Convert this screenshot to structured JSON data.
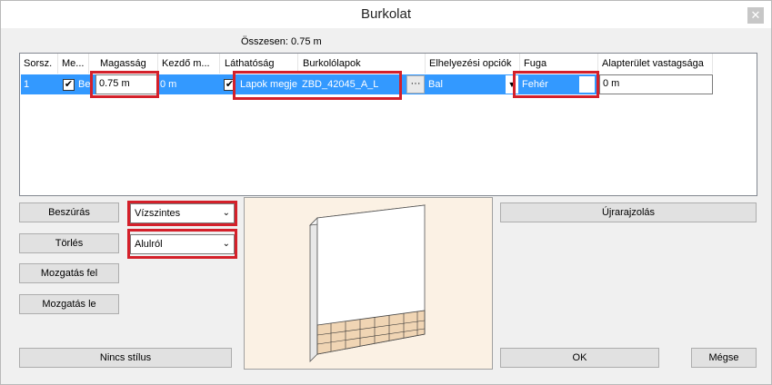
{
  "window": {
    "title": "Burkolat"
  },
  "summary": "Összesen: 0.75 m",
  "table": {
    "headers": [
      "Sorsz.",
      "Me...",
      "Magasság",
      "Kezdő m...",
      "Láthatóság",
      "Burkolólapok",
      "Elhelyezési opciók",
      "Fuga",
      "Alapterület vastagsága"
    ],
    "rows": [
      {
        "index": "1",
        "me_value": "Be",
        "height": "0.75 m",
        "start": "0 m",
        "visibility": "Lapok megjel",
        "tiles": "ZBD_42045_A_L",
        "placement": "Bal",
        "grout": "Fehér",
        "thickness": "0 m",
        "ellipsis": "···"
      }
    ]
  },
  "buttons": {
    "insert": "Beszúrás",
    "delete": "Törlés",
    "move_up": "Mozgatás fel",
    "move_down": "Mozgatás le",
    "no_style": "Nincs stílus",
    "redraw": "Újrarajzolás",
    "ok": "OK",
    "cancel": "Mégse"
  },
  "combos": {
    "orientation": "Vízszintes",
    "direction": "Alulról"
  },
  "colors": {
    "selection": "#3399ff",
    "highlight": "#d4202a",
    "preview_bg": "#fbf1e4",
    "tile": "#f0d5b4"
  }
}
